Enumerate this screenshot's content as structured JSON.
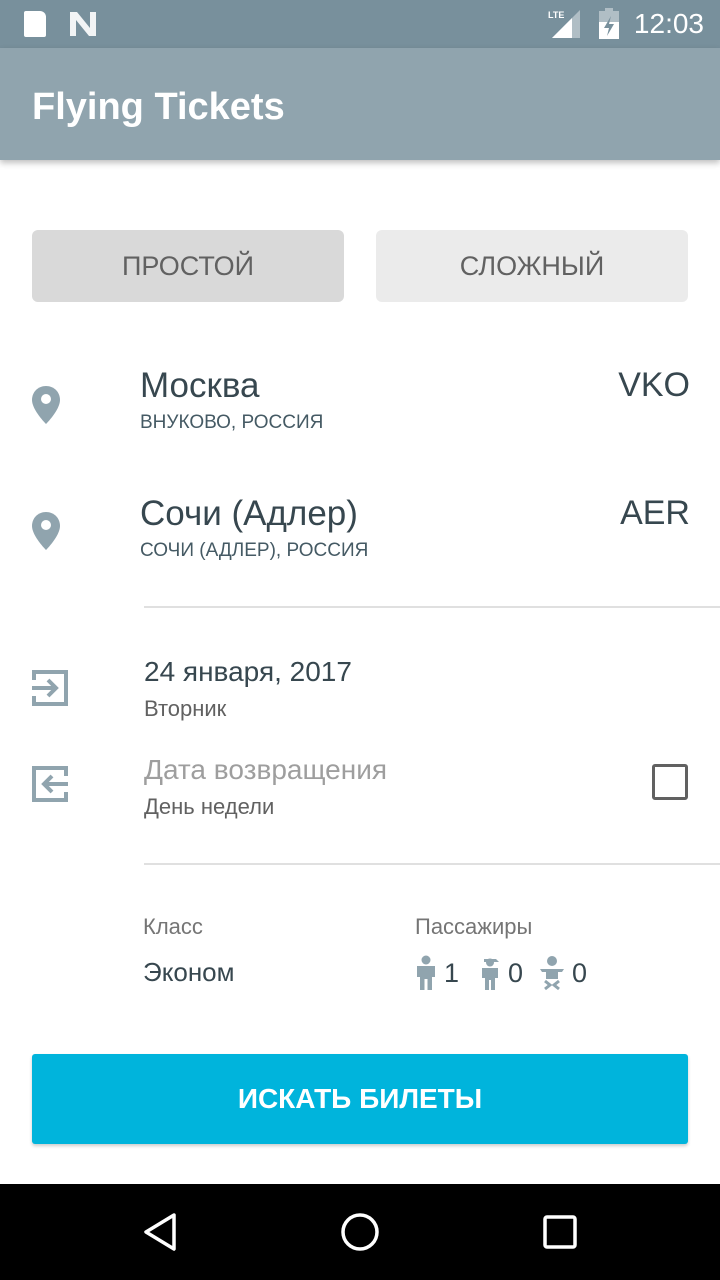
{
  "status_bar": {
    "time": "12:03",
    "network": "LTE",
    "icons": [
      "sd-card-icon",
      "n-notification-icon",
      "lte-signal-icon",
      "battery-charging-icon"
    ]
  },
  "app_bar": {
    "title": "Flying Tickets"
  },
  "mode_toggle": {
    "options": [
      {
        "label": "ПРОСТОЙ",
        "selected": true
      },
      {
        "label": "СЛОЖНЫЙ",
        "selected": false
      }
    ]
  },
  "origin": {
    "city": "Москва",
    "airport": "ВНУКОВО, РОССИЯ",
    "code": "VKO",
    "icon": "location-pin-icon"
  },
  "destination": {
    "city": "Сочи (Адлер)",
    "airport": "СОЧИ (АДЛЕР), РОССИЯ",
    "code": "AER",
    "icon": "location-pin-icon"
  },
  "departure": {
    "date": "24 января, 2017",
    "weekday": "Вторник",
    "icon": "login-arrow-icon"
  },
  "return": {
    "date_placeholder": "Дата возвращения",
    "weekday_placeholder": "День недели",
    "enabled": false,
    "icon": "logout-arrow-icon"
  },
  "class": {
    "label": "Класс",
    "value": "Эконом"
  },
  "passengers": {
    "label": "Пассажиры",
    "adults": "1",
    "children": "0",
    "infants": "0"
  },
  "search_button": {
    "label": "ИСКАТЬ БИЛЕТЫ",
    "color": "#00b4dc"
  },
  "nav_bar": {
    "buttons": [
      "back",
      "home",
      "recents"
    ]
  }
}
